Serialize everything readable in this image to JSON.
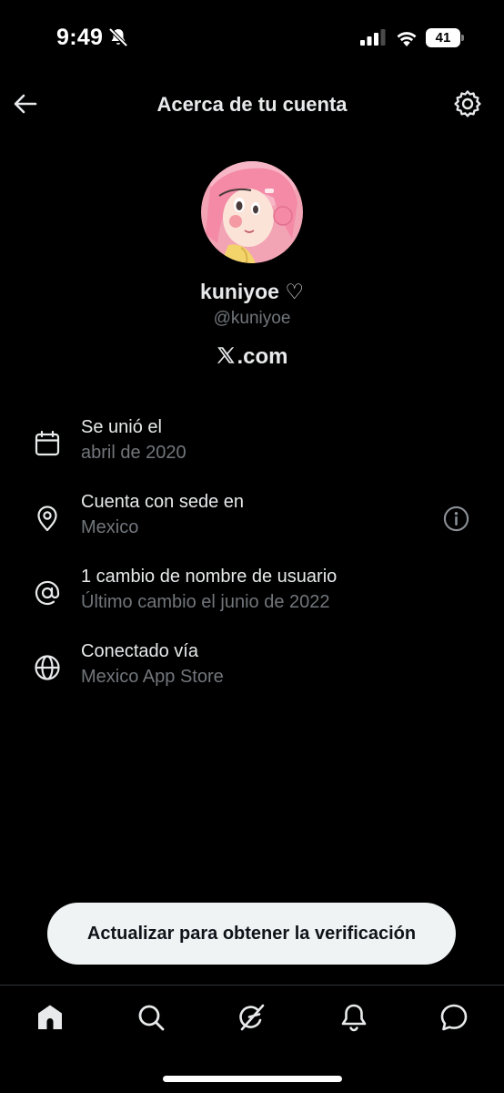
{
  "status_bar": {
    "time": "9:49",
    "battery_level": "41",
    "icons": [
      "bell-muted-icon",
      "cellular-signal-icon",
      "wifi-icon",
      "battery-icon"
    ]
  },
  "header": {
    "title": "Acerca de tu cuenta",
    "back_icon": "arrow-left-icon",
    "settings_icon": "gear-icon"
  },
  "profile": {
    "display_name": "kuniyoe ♡",
    "username": "@kuniyoe",
    "site": ".com",
    "site_logo": "x-logo-icon"
  },
  "info_rows": [
    {
      "icon": "calendar-icon",
      "title": "Se unió el",
      "subtitle": "abril de 2020"
    },
    {
      "icon": "location-pin-icon",
      "title": "Cuenta con sede en",
      "subtitle": "Mexico",
      "action_icon": "info-icon"
    },
    {
      "icon": "at-sign-icon",
      "title": "1 cambio de nombre de usuario",
      "subtitle": "Último cambio el junio de 2022"
    },
    {
      "icon": "globe-icon",
      "title": "Conectado vía",
      "subtitle": "Mexico App Store"
    }
  ],
  "upgrade_button": {
    "label": "Actualizar para obtener la verificación"
  },
  "bottom_nav": {
    "items": [
      "home-icon",
      "search-icon",
      "grok-icon",
      "bell-icon",
      "messages-icon"
    ],
    "active": "home-icon"
  },
  "colors": {
    "background": "#000000",
    "primary_text": "#e7e9ea",
    "secondary_text": "#71767b",
    "divider": "#2f3336",
    "pill_background": "#eff3f4"
  }
}
